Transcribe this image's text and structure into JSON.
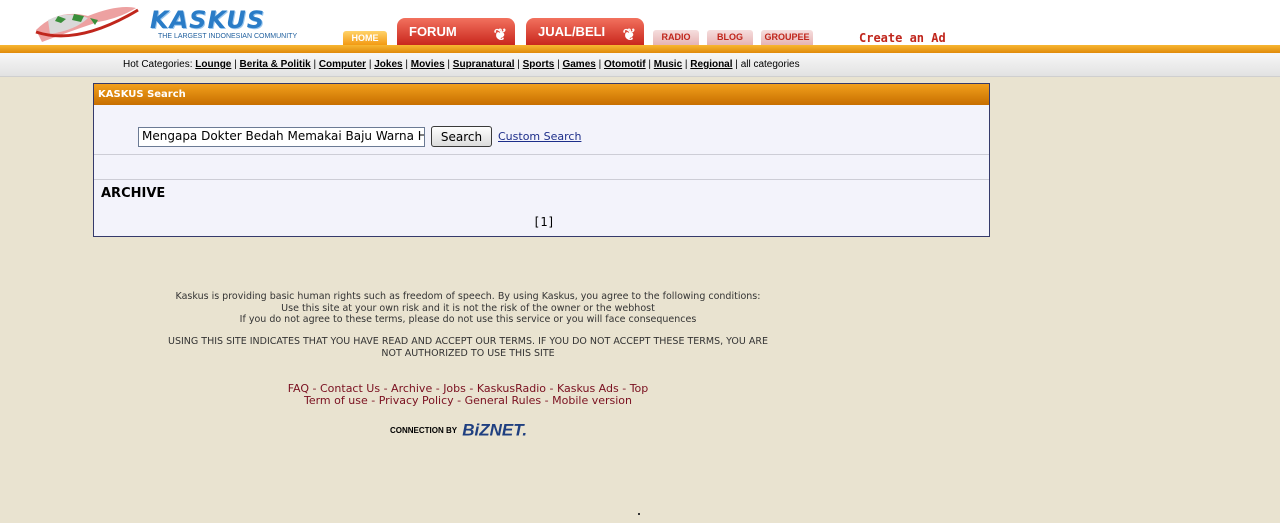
{
  "header": {
    "logo_text": "KASKUS",
    "tagline": "THE LARGEST INDONESIAN COMMUNITY",
    "tabs": {
      "home": "HOME",
      "forum": "FORUM",
      "jual_beli": "JUAL/BELI",
      "radio": "RADIO",
      "blog": "BLOG",
      "groupee": "GROUPEE"
    },
    "create_ad": "Create an Ad",
    "brand_color": "#e08a0a"
  },
  "hot_categories": {
    "label": "Hot Categories:",
    "items": [
      "Lounge",
      "Berita & Politik",
      "Computer",
      "Jokes",
      "Movies",
      "Supranatural",
      "Sports",
      "Games",
      "Otomotif",
      "Music",
      "Regional"
    ],
    "all": "all categories"
  },
  "search": {
    "title": "KASKUS Search",
    "query": "Mengapa Dokter Bedah Memakai Baju Warna Hijau",
    "button": "Search",
    "custom": "Custom Search",
    "section": "ARCHIVE",
    "pager": "[1]"
  },
  "footer": {
    "terms1": "Kaskus is providing basic human rights such as freedom of speech. By using Kaskus, you agree to the following conditions:",
    "terms2": "Use this site at your own risk and it is not the risk of the owner or the webhost",
    "terms3": "If you do not agree to these terms, please do not use this service or you will face consequences",
    "terms4": "USING THIS SITE INDICATES THAT YOU HAVE READ AND ACCEPT OUR TERMS. IF YOU DO NOT ACCEPT THESE TERMS, YOU ARE",
    "terms5": "NOT AUTHORIZED TO USE THIS SITE",
    "links_row1": [
      "FAQ",
      "Contact Us",
      "Archive",
      "Jobs",
      "KaskusRadio",
      "Kaskus Ads",
      "Top"
    ],
    "links_row2": [
      "Term of use",
      "Privacy Policy",
      "General Rules",
      "Mobile version"
    ],
    "connection": "CONNECTION BY",
    "biznet": "BiZNET."
  }
}
